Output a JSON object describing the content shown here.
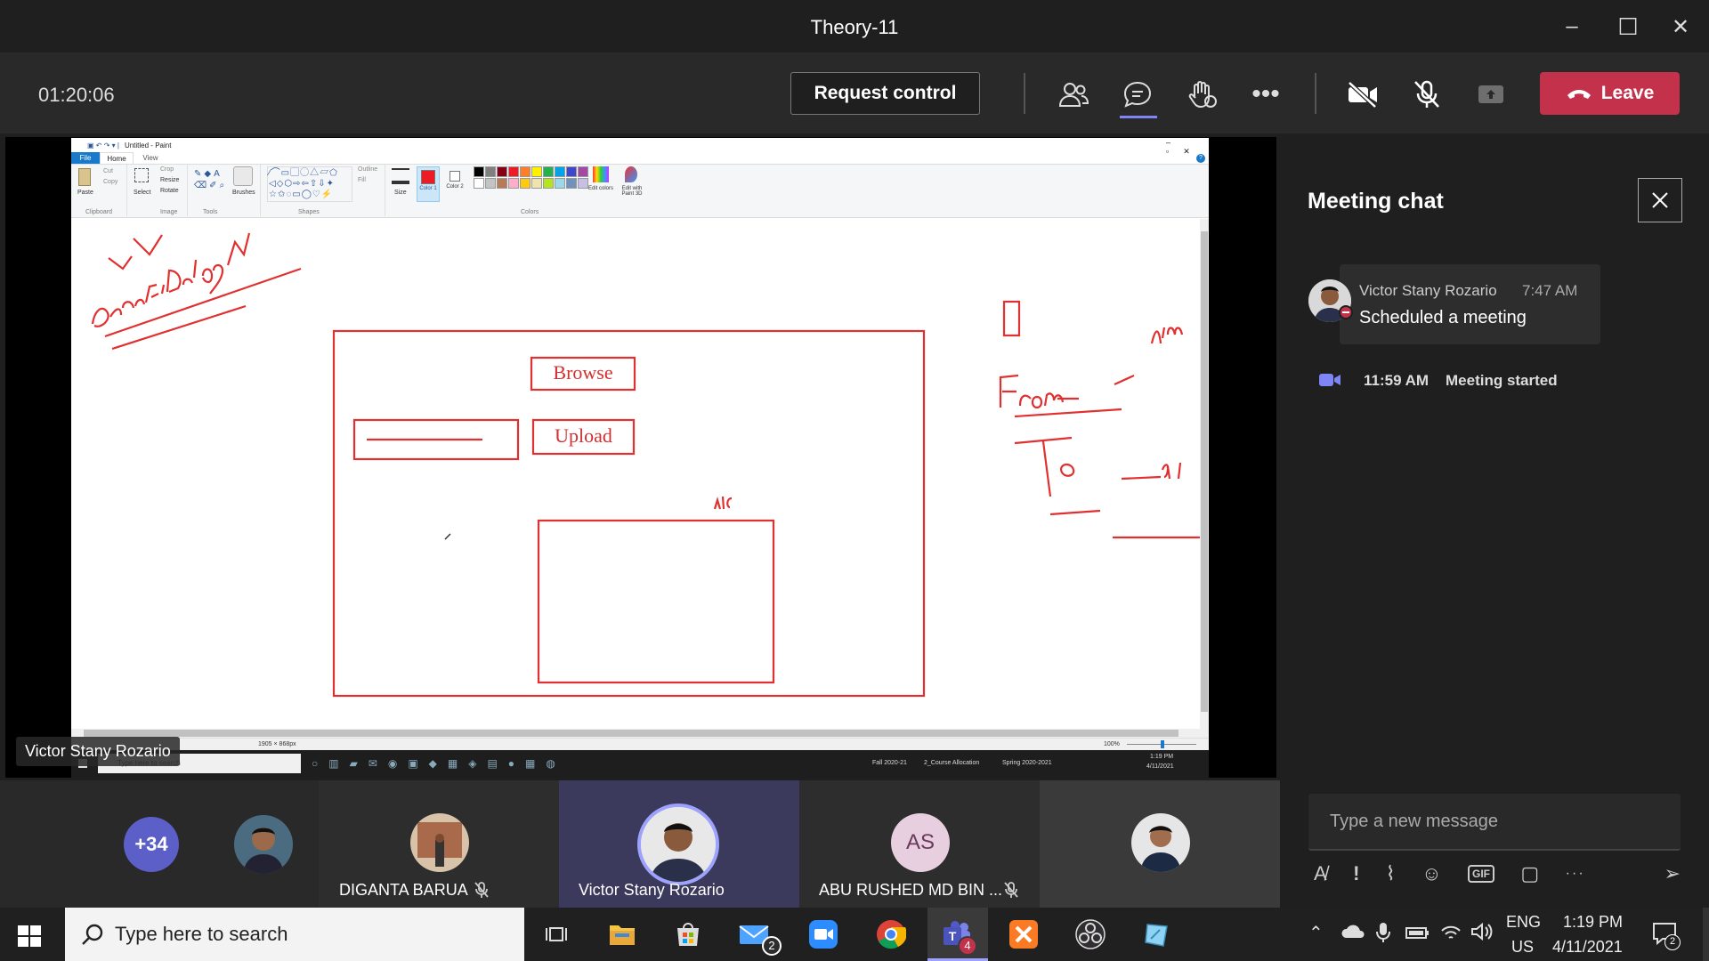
{
  "window": {
    "title": "Theory-11",
    "minimize_glyph": "–",
    "maximize_glyph": "☐",
    "close_glyph": "✕"
  },
  "toolbar": {
    "timer": "01:20:06",
    "request_control": "Request control",
    "leave": "Leave",
    "icons": [
      "participants-icon",
      "chat-icon",
      "raise-hand-icon",
      "more-options-icon",
      "camera-off-icon",
      "mic-off-icon",
      "share-tray-icon"
    ],
    "leave_color": "#c4314b"
  },
  "paint": {
    "window_title": "Untitled - Paint",
    "tabs": [
      "File",
      "Home",
      "View"
    ],
    "clipboard": {
      "paste": "Paste",
      "cut": "Cut",
      "copy": "Copy",
      "group": "Clipboard"
    },
    "image": {
      "select": "Select",
      "crop": "Crop",
      "resize": "Resize",
      "rotate": "Rotate",
      "group": "Image"
    },
    "tools_group": "Tools",
    "brushes": "Brushes",
    "shapes": {
      "outline": "Outline",
      "fill": "Fill",
      "group": "Shapes"
    },
    "size": "Size",
    "color1": "Color 1",
    "color2": "Color 2",
    "colors_group": "Colors",
    "edit_colors": "Edit colors",
    "edit_paint3d": "Edit with Paint 3D",
    "palette": [
      "#000000",
      "#7f7f7f",
      "#880015",
      "#ed1c24",
      "#ff7f27",
      "#fff200",
      "#22b14c",
      "#00a2e8",
      "#3f48cc",
      "#a349a4",
      "#ffffff",
      "#c3c3c3",
      "#b97a57",
      "#ffaec9",
      "#ffc90e",
      "#efe4b0",
      "#b5e61d",
      "#99d9ea",
      "#7092be",
      "#c8bfe7"
    ],
    "canvas_labels": {
      "browse": "Browse",
      "upload": "Upload"
    },
    "statusbar": {
      "dimensions": "1905 × 868px",
      "zoom": "100%"
    }
  },
  "remote_taskbar": {
    "search_placeholder": "Type here to search",
    "items": [
      "Fall 2020-21",
      "2_Course Allocation",
      "Spring 2020-2021"
    ],
    "time": "1:19 PM",
    "date": "4/11/2021"
  },
  "presenter_label": "Victor Stany Rozario",
  "chat": {
    "title": "Meeting chat",
    "message": {
      "author": "Victor Stany Rozario",
      "time": "7:47 AM",
      "text": "Scheduled a meeting"
    },
    "event": {
      "time": "11:59 AM",
      "text": "Meeting started"
    },
    "composer_placeholder": "Type a new message",
    "composer_icons": [
      "format-icon",
      "important-icon",
      "attach-icon",
      "emoji-icon",
      "gif-icon",
      "sticker-icon",
      "more-icon",
      "send-icon"
    ]
  },
  "participants": {
    "overflow": "+34",
    "tiles": [
      {
        "name": "DIGANTA BARUA",
        "muted": true
      },
      {
        "name": "Victor Stany Rozario",
        "muted": false
      },
      {
        "name": "ABU RUSHED MD BIN ...",
        "initials": "AS",
        "muted": true
      },
      {
        "name": "",
        "muted": false
      }
    ]
  },
  "taskbar": {
    "search_placeholder": "Type here to search",
    "mail_badge": "2",
    "teams_badge": "4",
    "lang": "ENG",
    "region": "US",
    "time": "1:19 PM",
    "date": "4/11/2021",
    "notif_badge": "2"
  }
}
